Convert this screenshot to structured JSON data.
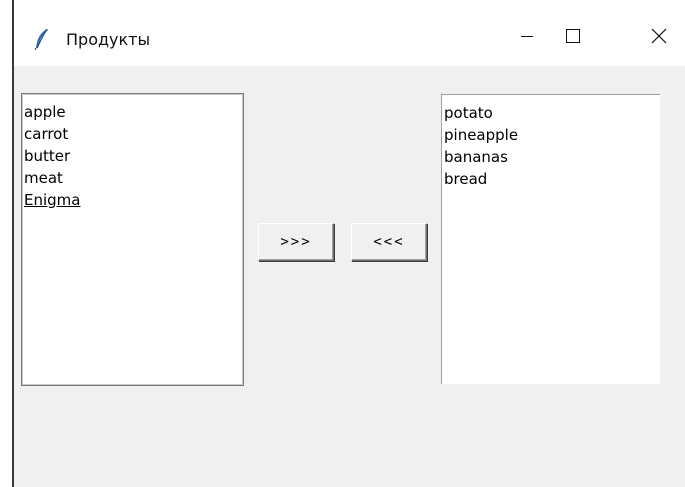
{
  "window": {
    "title": "Продукты"
  },
  "left_list": {
    "items": [
      "apple",
      "carrot",
      "butter",
      "meat",
      "Enigma"
    ],
    "active_index": 4
  },
  "buttons": {
    "move_right_label": ">>>",
    "move_left_label": "<<<"
  },
  "right_list": {
    "items": [
      "potato",
      "pineapple",
      "bananas",
      "bread"
    ]
  },
  "icons": {
    "app": "feather-icon",
    "minimize": "minimize-icon",
    "maximize": "maximize-icon",
    "close": "close-icon"
  },
  "colors": {
    "client_background": "#f0f0f0",
    "titlebar_background": "#ffffff",
    "listbox_background": "#ffffff"
  }
}
